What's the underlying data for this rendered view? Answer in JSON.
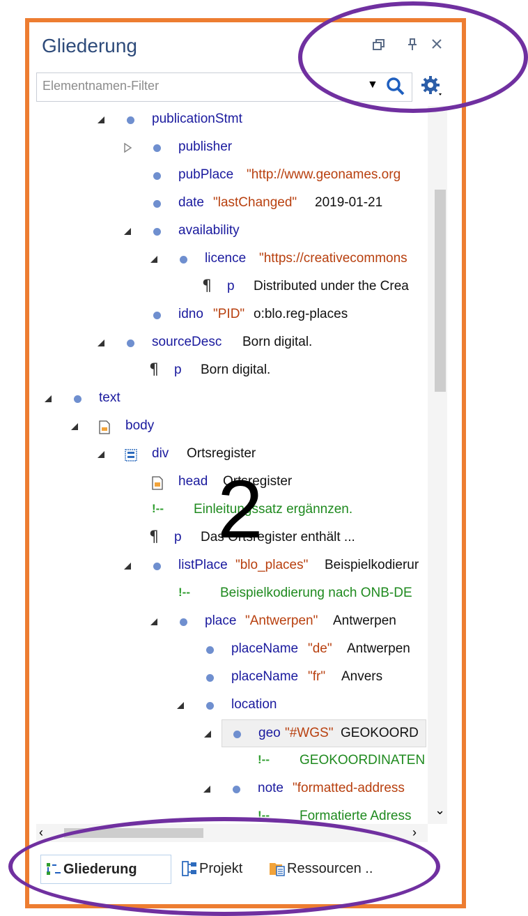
{
  "panel": {
    "title": "Gliederung",
    "restore_icon": "restore-window-icon",
    "pin_icon": "pin-icon",
    "close_icon": "close-icon"
  },
  "filter": {
    "placeholder": "Elementnamen-Filter"
  },
  "tree": [
    {
      "name": "publicationStmt",
      "attr": "",
      "text": ""
    },
    {
      "name": "publisher",
      "attr": "",
      "text": ""
    },
    {
      "name": "pubPlace",
      "attr": "\"http://www.geonames.org",
      "text": ""
    },
    {
      "name": "date",
      "attr": "\"lastChanged\"",
      "text": "2019-01-21"
    },
    {
      "name": "availability",
      "attr": "",
      "text": ""
    },
    {
      "name": "licence",
      "attr": "\"https://creativecommons",
      "text": ""
    },
    {
      "name": "p",
      "attr": "",
      "text": "Distributed under the Crea"
    },
    {
      "name": "idno",
      "attr": "\"PID\"",
      "text": "o:blo.reg-places"
    },
    {
      "name": "sourceDesc",
      "attr": "",
      "text": "Born digital."
    },
    {
      "name": "p",
      "attr": "",
      "text": "Born digital."
    },
    {
      "name": "text",
      "attr": "",
      "text": ""
    },
    {
      "name": "body",
      "attr": "",
      "text": ""
    },
    {
      "name": "div",
      "attr": "",
      "text": "Ortsregister"
    },
    {
      "name": "head",
      "attr": "",
      "text": "Ortsregister"
    },
    {
      "name": "",
      "attr": "",
      "text": "Einleitungssatz ergännzen."
    },
    {
      "name": "p",
      "attr": "",
      "text": "Das Ortsregister enthält ..."
    },
    {
      "name": "listPlace",
      "attr": "\"blo_places\"",
      "text": "Beispielkodierur"
    },
    {
      "name": "",
      "attr": "",
      "text": "Beispielkodierung nach ONB-DE"
    },
    {
      "name": "place",
      "attr": "\"Antwerpen\"",
      "text": "Antwerpen"
    },
    {
      "name": "placeName",
      "attr": "\"de\"",
      "text": "Antwerpen"
    },
    {
      "name": "placeName",
      "attr": "\"fr\"",
      "text": "Anvers"
    },
    {
      "name": "location",
      "attr": "",
      "text": ""
    },
    {
      "name": "geo",
      "attr": "\"#WGS\"",
      "text": "GEOKOORD"
    },
    {
      "name": "",
      "attr": "",
      "text": "GEOKOORDINATEN"
    },
    {
      "name": "note",
      "attr": "\"formatted-address",
      "text": ""
    },
    {
      "name": "",
      "attr": "",
      "text": "Formatierte Adress"
    }
  ],
  "tabs": [
    {
      "label": "Gliederung",
      "icon": "outline-icon"
    },
    {
      "label": "Projekt",
      "icon": "project-icon"
    },
    {
      "label": "Ressourcen ..",
      "icon": "resources-icon"
    }
  ],
  "overlay": {
    "number": "2"
  },
  "colors": {
    "frame": "#ed7d31",
    "ellipse": "#7030a0",
    "element": "#1a1a9e",
    "attribute": "#b8400f",
    "comment": "#1f8a1f"
  }
}
